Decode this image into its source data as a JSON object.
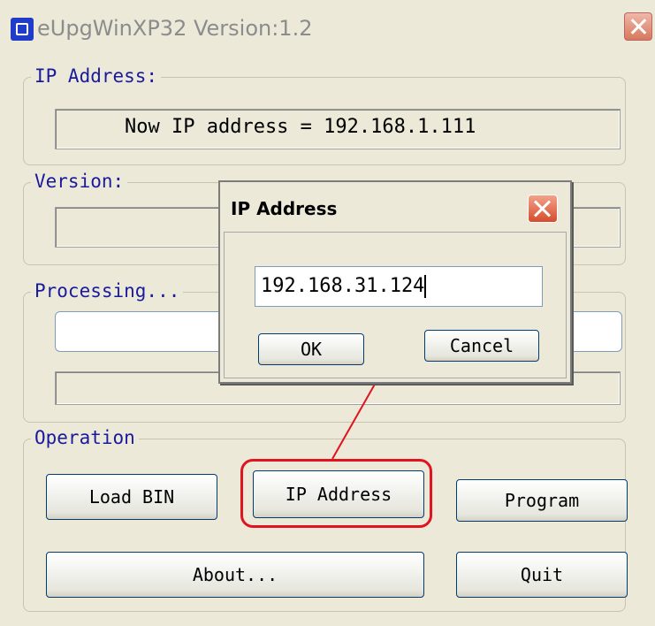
{
  "window": {
    "title": "eUpgWinXP32 Version:1.2",
    "close_icon": "close-icon"
  },
  "ip_group": {
    "legend": "IP Address:",
    "value": "Now IP address = 192.168.1.111"
  },
  "version_group": {
    "legend": "Version:",
    "value": ""
  },
  "processing_group": {
    "legend": "Processing...",
    "value": "",
    "progress": 0
  },
  "operation_group": {
    "legend": "Operation",
    "buttons": {
      "load_bin": "Load BIN",
      "ip_address": "IP Address",
      "program": "Program",
      "about": "About...",
      "quit": "Quit"
    }
  },
  "dialog": {
    "title": "IP Address",
    "input_value": "192.168.31.124",
    "ok": "OK",
    "cancel": "Cancel"
  },
  "colors": {
    "accent": "#e0141e",
    "legend": "#1a1a9e"
  }
}
